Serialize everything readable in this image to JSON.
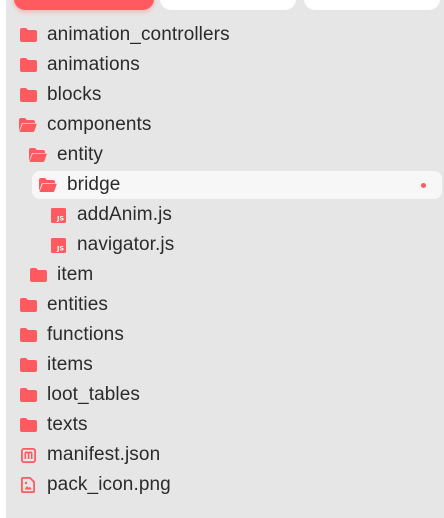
{
  "accent_color": "#ff5a5f",
  "tree": {
    "items": [
      {
        "label": "animation_controllers",
        "icon": "folder-icon"
      },
      {
        "label": "animations",
        "icon": "folder-icon"
      },
      {
        "label": "blocks",
        "icon": "folder-icon"
      },
      {
        "label": "components",
        "icon": "folder-open-icon"
      },
      {
        "label": "entity",
        "icon": "folder-open-icon"
      },
      {
        "label": "bridge",
        "icon": "folder-open-icon"
      },
      {
        "label": "addAnim.js",
        "icon": "js-file-icon"
      },
      {
        "label": "navigator.js",
        "icon": "js-file-icon"
      },
      {
        "label": "item",
        "icon": "folder-icon"
      },
      {
        "label": "entities",
        "icon": "folder-icon"
      },
      {
        "label": "functions",
        "icon": "folder-icon"
      },
      {
        "label": "items",
        "icon": "folder-icon"
      },
      {
        "label": "loot_tables",
        "icon": "folder-icon"
      },
      {
        "label": "texts",
        "icon": "folder-icon"
      },
      {
        "label": "manifest.json",
        "icon": "manifest-file-icon"
      },
      {
        "label": "pack_icon.png",
        "icon": "image-file-icon"
      }
    ]
  }
}
